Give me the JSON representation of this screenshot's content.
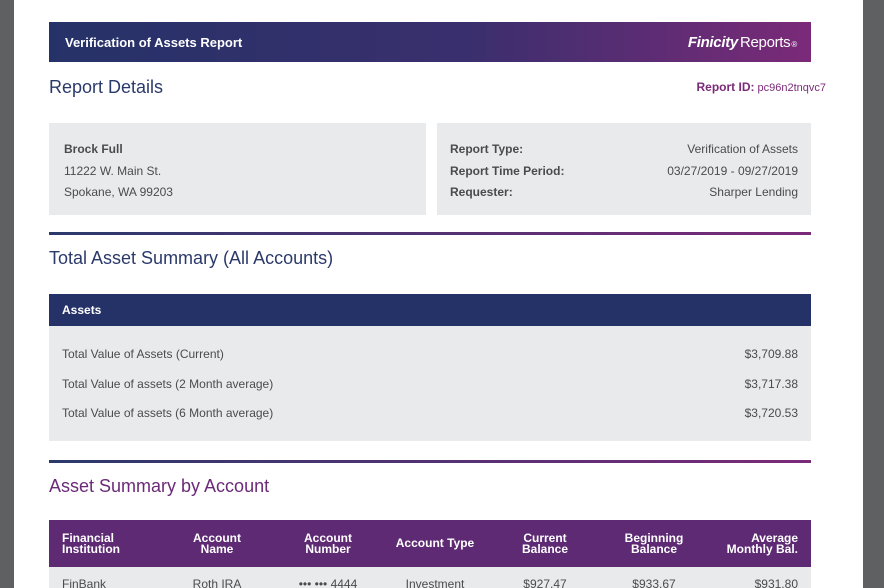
{
  "header": {
    "title": "Verification of Assets Report",
    "brand_main": "Finicity",
    "brand_sub": "Reports",
    "brand_mark": "®"
  },
  "report": {
    "details_title": "Report Details",
    "id_label": "Report ID:",
    "id_value": "pc96n2tnqvc7"
  },
  "customer": {
    "name": "Brock Full",
    "street": "11222 W. Main St.",
    "city": "Spokane, WA 99203"
  },
  "meta": [
    {
      "label": "Report Type:",
      "value": "Verification of Assets"
    },
    {
      "label": "Report Time Period:",
      "value": "03/27/2019 - 09/27/2019"
    },
    {
      "label": "Requester:",
      "value": "Sharper Lending"
    }
  ],
  "summary": {
    "title": "Total Asset Summary (All Accounts)",
    "header": "Assets",
    "rows": [
      {
        "label": "Total Value of Assets (Current)",
        "value": "$3,709.88"
      },
      {
        "label": "Total Value of assets (2 Month average)",
        "value": "$3,717.38"
      },
      {
        "label": "Total Value of assets (6 Month average)",
        "value": "$3,720.53"
      }
    ]
  },
  "by_account": {
    "title": "Asset Summary by Account",
    "columns": [
      {
        "line1": "Financial",
        "line2": "Institution"
      },
      {
        "line1": "Account",
        "line2": "Name"
      },
      {
        "line1": "Account",
        "line2": "Number"
      },
      {
        "line1": "Account Type",
        "line2": ""
      },
      {
        "line1": "Current",
        "line2": "Balance"
      },
      {
        "line1": "Beginning",
        "line2": "Balance"
      },
      {
        "line1": "Average",
        "line2": "Monthly Bal."
      }
    ],
    "rows": [
      {
        "institution": "FinBank",
        "name": "Roth IRA",
        "number": "••• ••• 4444",
        "type": "Investment",
        "current": "$927.47",
        "beginning": "$933.67",
        "average": "$931.80"
      }
    ]
  }
}
